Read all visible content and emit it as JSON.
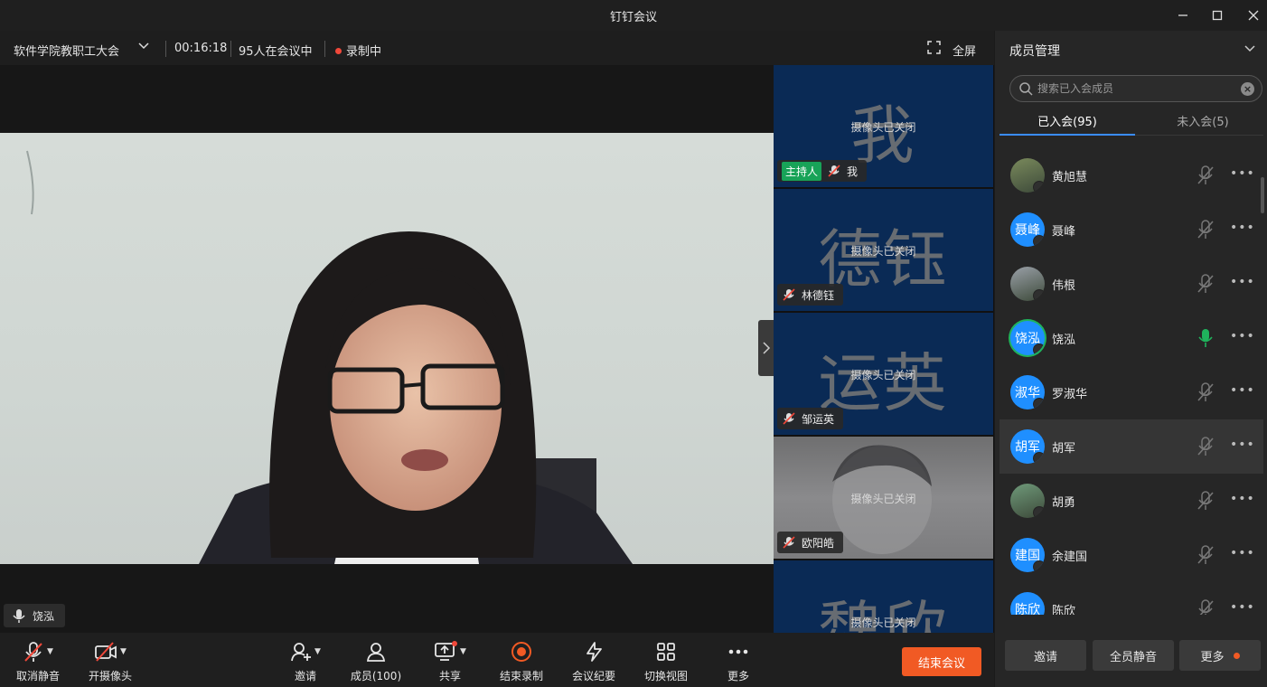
{
  "window": {
    "title": "钉钉会议"
  },
  "meeting": {
    "name": "软件学院教职工大会",
    "duration": "00:16:18",
    "participants_status": "95人在会议中",
    "recording_status": "录制中",
    "fullscreen_label": "全屏"
  },
  "stage": {
    "speaker_name": "饶泓"
  },
  "tiles": [
    {
      "big": "我",
      "camera": "摄像头已关闭",
      "host_badge": "主持人",
      "name": "我"
    },
    {
      "big": "德钰",
      "camera": "摄像头已关闭",
      "name": "林德钰"
    },
    {
      "big": "运英",
      "camera": "摄像头已关闭",
      "name": "邹运英"
    },
    {
      "big": "",
      "camera": "摄像头已关闭",
      "name": "欧阳皓"
    },
    {
      "big": "魏欣",
      "camera": "摄像头已关闭",
      "name": ""
    }
  ],
  "toolbar": {
    "unmute": "取消静音",
    "camera": "开摄像头",
    "invite": "邀请",
    "members": "成员(100)",
    "share": "共享",
    "end_recording": "结束录制",
    "minutes": "会议纪要",
    "switch_view": "切换视图",
    "more": "更多",
    "end_meeting": "结束会议"
  },
  "panel": {
    "title": "成员管理",
    "search_placeholder": "搜索已入会成员",
    "tab_joined": "已入会(95)",
    "tab_not_joined": "未入会(5)",
    "members": [
      {
        "name": "黄旭慧",
        "avatar": "",
        "mic": "muted",
        "photo": true
      },
      {
        "name": "聂峰",
        "avatar": "聂峰",
        "mic": "muted"
      },
      {
        "name": "伟根",
        "avatar": "",
        "mic": "muted",
        "photo": true
      },
      {
        "name": "饶泓",
        "avatar": "饶泓",
        "mic": "active"
      },
      {
        "name": "罗淑华",
        "avatar": "淑华",
        "mic": "muted"
      },
      {
        "name": "胡军",
        "avatar": "胡军",
        "mic": "muted"
      },
      {
        "name": "胡勇",
        "avatar": "",
        "mic": "muted",
        "photo": true
      },
      {
        "name": "余建国",
        "avatar": "建国",
        "mic": "muted"
      },
      {
        "name": "陈欣",
        "avatar": "陈欣",
        "mic": "muted"
      }
    ],
    "more_dots": "•••",
    "invite_btn": "邀请",
    "mute_all_btn": "全员静音",
    "more_btn": "更多"
  }
}
